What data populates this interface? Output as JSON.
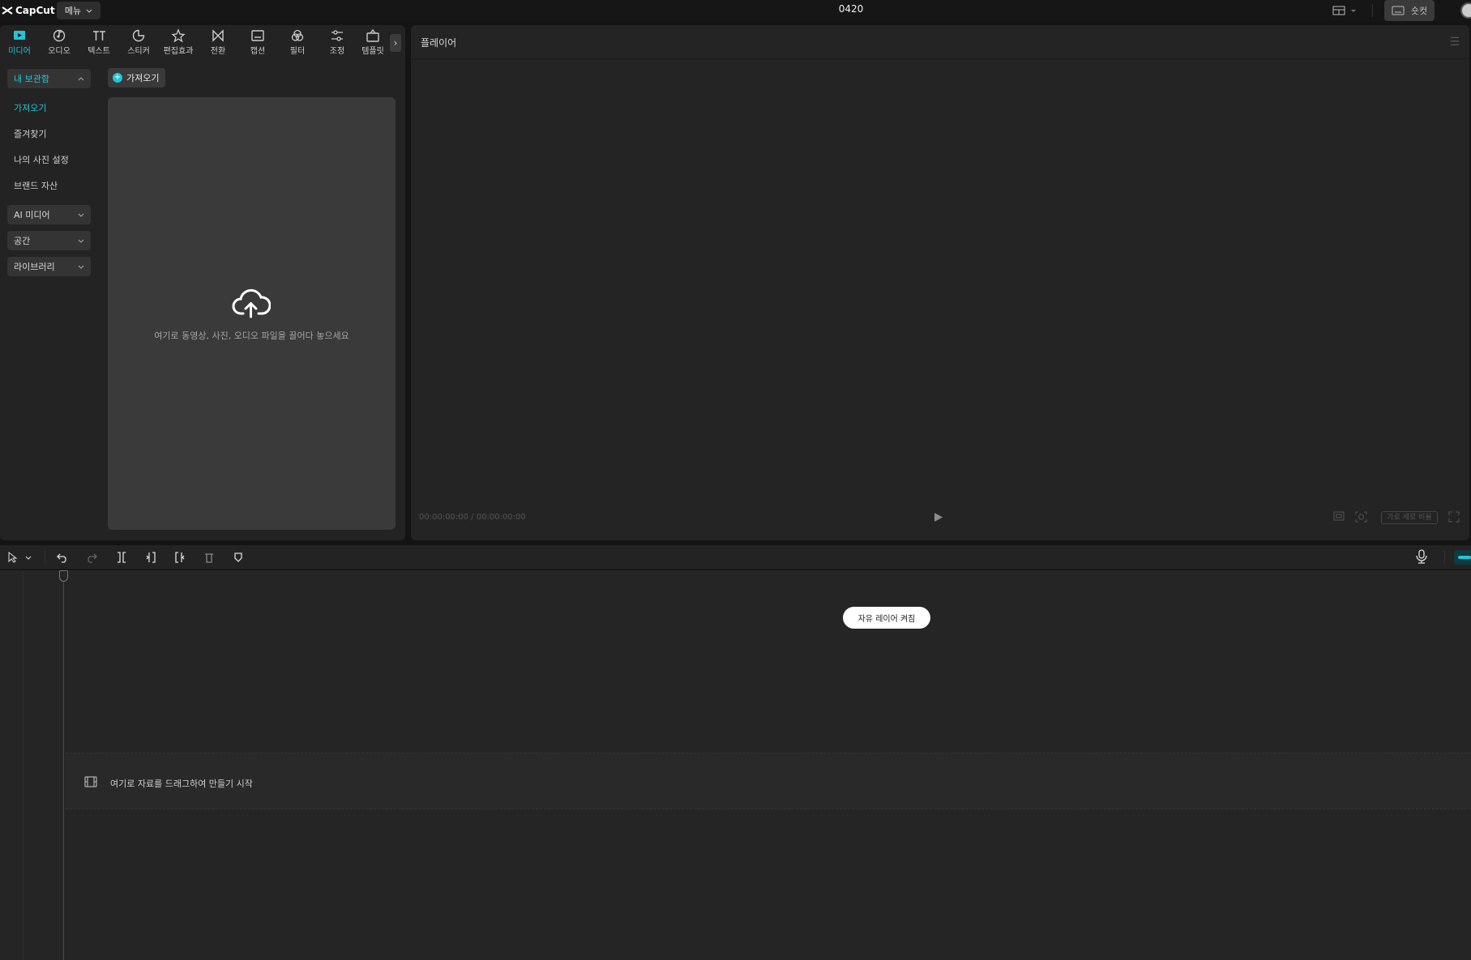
{
  "app": {
    "logo_text": "CapCut",
    "menu_label": "메뉴",
    "doc_title": "0420",
    "shortcut_label": "숏컷"
  },
  "tabs": [
    {
      "label": "미디어",
      "icon": "media-icon",
      "active": true
    },
    {
      "label": "오디오",
      "icon": "audio-icon"
    },
    {
      "label": "텍스트",
      "icon": "text-icon"
    },
    {
      "label": "스티커",
      "icon": "sticker-icon"
    },
    {
      "label": "편집효과",
      "icon": "effects-icon"
    },
    {
      "label": "전환",
      "icon": "transition-icon"
    },
    {
      "label": "캡션",
      "icon": "caption-icon"
    },
    {
      "label": "필터",
      "icon": "filter-icon"
    },
    {
      "label": "조정",
      "icon": "adjust-icon"
    },
    {
      "label": "템플릿",
      "icon": "template-icon"
    }
  ],
  "sidebar": {
    "my_library": "내 보관함",
    "items": [
      "가져오기",
      "즐겨찾기",
      "나의 사진 설정",
      "브랜드 자산"
    ],
    "groups": [
      "AI 미디어",
      "공간",
      "라이브러리"
    ]
  },
  "media": {
    "import_label": "가져오기",
    "drop_text": "여기로 동영상, 사진, 오디오 파일을 끌어다 놓으세요"
  },
  "player": {
    "title": "플레이어",
    "timecode": "00:00:00:00 / 00:00:00:00",
    "ratio_label": "가로 세로 비율"
  },
  "timeline": {
    "free_layer_label": "자유 레이어 켜짐",
    "main_track_hint": "여기로 자료를 드래그하여 만들기 시작"
  },
  "colors": {
    "accent": "#22c5d6",
    "panel": "#232323",
    "bg": "#141414"
  }
}
